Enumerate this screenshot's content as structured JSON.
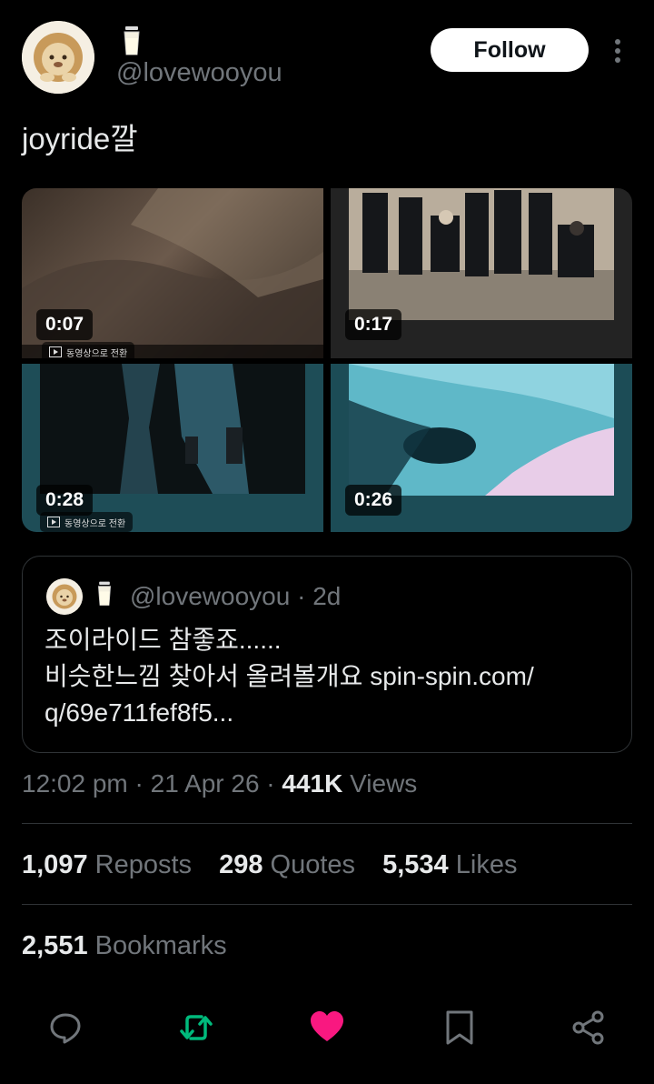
{
  "header": {
    "handle": "@lovewooyou",
    "follow_label": "Follow"
  },
  "tweet": {
    "text": "joyride깔"
  },
  "media": {
    "videos": [
      {
        "duration": "0:07",
        "caption": "동영상으로 전환"
      },
      {
        "duration": "0:17"
      },
      {
        "duration": "0:28",
        "caption": "동영상으로 전환"
      },
      {
        "duration": "0:26"
      }
    ]
  },
  "quote": {
    "handle": "@lovewooyou",
    "separator": "·",
    "age": "2d",
    "line1": "조이라이드 참좋죠......",
    "line2": "비슷한느낌 찾아서 올려볼개요 spin-spin.com/",
    "line3": "q/69e711fef8f5..."
  },
  "meta": {
    "time": "12:02 pm",
    "dot1": "·",
    "date": "21 Apr 26",
    "dot2": "·",
    "views_count": "441K",
    "views_label": "Views"
  },
  "stats": {
    "reposts_count": "1,097",
    "reposts_label": "Reposts",
    "quotes_count": "298",
    "quotes_label": "Quotes",
    "likes_count": "5,534",
    "likes_label": "Likes",
    "bookmarks_count": "2,551",
    "bookmarks_label": "Bookmarks"
  },
  "actions": {
    "reply_icon": "reply-icon",
    "repost_icon": "repost-icon",
    "like_icon": "like-icon",
    "bookmark_icon": "bookmark-icon",
    "share_icon": "share-icon",
    "repost_color": "#00ba7c",
    "like_color": "#f91880",
    "icon_color": "#71767b"
  }
}
